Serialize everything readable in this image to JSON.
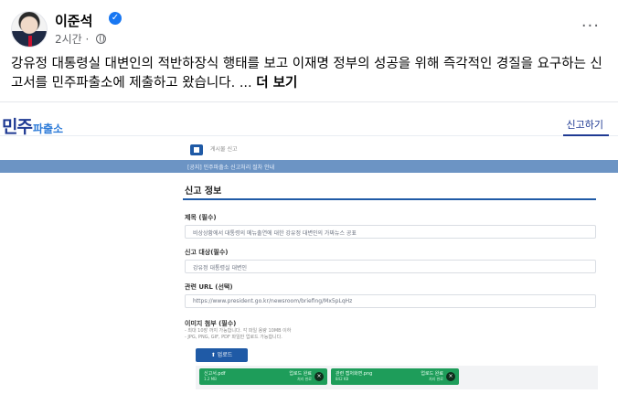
{
  "post": {
    "author": "이준석",
    "verified_mark": "✓",
    "time": "2시간",
    "separator": " · ",
    "more_menu": "···",
    "text": "강유정 대통령실 대변인의 적반하장식 행태를 보고 이재명 정부의 성공을 위해 즉각적인 경질을 요구하는 신고서를 민주파출소에 제출하고 왔습니다. ...",
    "more_label": "더 보기"
  },
  "site": {
    "logo_main": "민주",
    "logo_sub": "파출소",
    "nav_report": "신고하기",
    "breadcrumb": "게시물 신고",
    "bar_text": "[공지] 민주파출소 신고처리 절차 안내"
  },
  "form": {
    "title": "신고 정보",
    "fields": [
      {
        "label": "제목 (필수)",
        "value": "비상상황에서 대통령의 메뉴출연에 대한 강유정 대변인의 가짜뉴스 공표"
      },
      {
        "label": "신고 대상(필수)",
        "value": "강유정 대통령실 대변인"
      },
      {
        "label": "관련 URL (선택)",
        "value": "https://www.president.go.kr/newsroom/briefing/Mx5pLqHz"
      }
    ],
    "image_label": "이미지 첨부 (필수)",
    "hints": [
      "- 최대 10장 까지 가능합니다. 각 파일 용량 10MB 이하",
      "- JPG, PNG, GIF, PDF 파일만 업로드 가능합니다."
    ],
    "upload_label": "⬆ 업로드",
    "files": [
      {
        "name": "신고서.pdf",
        "size": "1.2 MB",
        "status": "업로드 완료",
        "status2": "처리 완료"
      },
      {
        "name": "관련 캡처화면.png",
        "size": "842 KB",
        "status": "업로드 완료",
        "status2": "처리 완료"
      }
    ],
    "close_glyph": "×"
  }
}
